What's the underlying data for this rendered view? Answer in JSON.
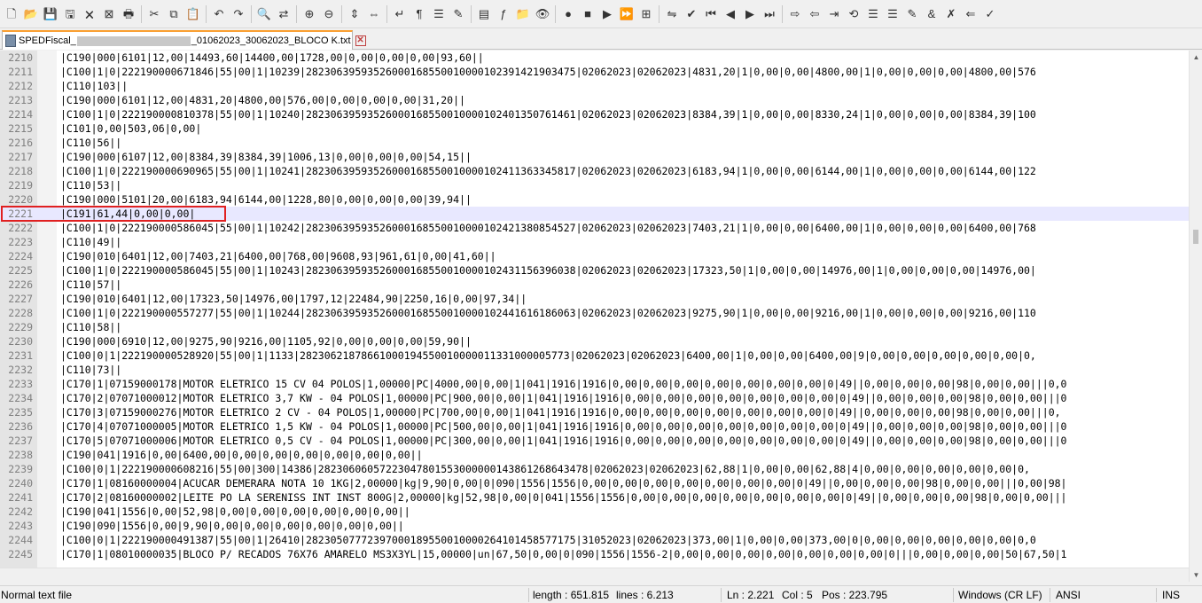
{
  "toolbar": {
    "icons": [
      "new-file-icon",
      "open-file-icon",
      "save-icon",
      "save-all-icon",
      "close-icon",
      "close-all-icon",
      "print-icon",
      "cut-icon",
      "copy-icon",
      "paste-icon",
      "undo-icon",
      "redo-icon",
      "find-icon",
      "replace-icon",
      "zoom-in-icon",
      "zoom-out-icon",
      "sync-vertical-icon",
      "sync-horizontal-icon",
      "word-wrap-icon",
      "show-all-chars-icon",
      "indent-guide-icon",
      "udl-icon",
      "doc-map-icon",
      "function-list-icon",
      "folder-as-workspace-icon",
      "monitoring-icon",
      "record-macro-icon",
      "stop-recording-icon",
      "play-macro-icon",
      "run-macro-multiple-icon",
      "save-macro-icon",
      "compare-icon",
      "compare-check-icon",
      "first-diff-icon",
      "prev-diff-icon",
      "next-diff-icon",
      "last-diff-icon",
      "plugin-a-icon",
      "plugin-b-icon",
      "plugin-c-icon",
      "plugin-d-icon",
      "plugin-e-icon",
      "plugin-f-icon",
      "plugin-g-icon",
      "plugin-h-icon",
      "plugin-i-icon",
      "plugin-j-icon",
      "plugin-k-icon"
    ],
    "glyphs": [
      "🗋",
      "📂",
      "💾",
      "🖫",
      "🗙",
      "⊠",
      "🖶",
      "✂",
      "⧉",
      "📋",
      "↶",
      "↷",
      "🔍",
      "⇄",
      "⊕",
      "⊖",
      "⇕",
      "⇔",
      "↵",
      "¶",
      "☰",
      "✎",
      "▤",
      "ƒ",
      "📁",
      "👁",
      "●",
      "■",
      "▶",
      "⏩",
      "⊞",
      "⇋",
      "✔",
      "⏮",
      "◀",
      "▶",
      "⏭",
      "⇨",
      "⇦",
      "⇥",
      "⟲",
      "☰",
      "☰",
      "✎",
      "&",
      "✗",
      "⇐",
      "✓",
      "🔧"
    ]
  },
  "tab": {
    "prefix": "SPEDFiscal_",
    "suffix": "_01062023_30062023_BLOCO K.txt",
    "close": "✕"
  },
  "editor": {
    "current_line": "2221",
    "lines": [
      {
        "n": "2210",
        "t": "|C190|000|6101|12,00|14493,60|14400,00|1728,00|0,00|0,00|0,00|93,60||"
      },
      {
        "n": "2211",
        "t": "|C100|1|0|222190000671846|55|00|1|10239|28230639593526000168550010000102391421903475|02062023|02062023|4831,20|1|0,00|0,00|4800,00|1|0,00|0,00|0,00|4800,00|576"
      },
      {
        "n": "2212",
        "t": "|C110|103||"
      },
      {
        "n": "2213",
        "t": "|C190|000|6101|12,00|4831,20|4800,00|576,00|0,00|0,00|0,00|31,20||"
      },
      {
        "n": "2214",
        "t": "|C100|1|0|222190000810378|55|00|1|10240|28230639593526000168550010000102401350761461|02062023|02062023|8384,39|1|0,00|0,00|8330,24|1|0,00|0,00|0,00|8384,39|100"
      },
      {
        "n": "2215",
        "t": "|C101|0,00|503,06|0,00|"
      },
      {
        "n": "2216",
        "t": "|C110|56||"
      },
      {
        "n": "2217",
        "t": "|C190|000|6107|12,00|8384,39|8384,39|1006,13|0,00|0,00|0,00|54,15||"
      },
      {
        "n": "2218",
        "t": "|C100|1|0|222190000690965|55|00|1|10241|28230639593526000168550010000102411363345817|02062023|02062023|6183,94|1|0,00|0,00|6144,00|1|0,00|0,00|0,00|6144,00|122"
      },
      {
        "n": "2219",
        "t": "|C110|53||"
      },
      {
        "n": "2220",
        "t": "|C190|000|5101|20,00|6183,94|6144,00|1228,80|0,00|0,00|0,00|39,94||"
      },
      {
        "n": "2221",
        "t": "|C191|61,44|0,00|0,00|"
      },
      {
        "n": "2222",
        "t": "|C100|1|0|222190000586045|55|00|1|10242|28230639593526000168550010000102421380854527|02062023|02062023|7403,21|1|0,00|0,00|6400,00|1|0,00|0,00|0,00|6400,00|768"
      },
      {
        "n": "2223",
        "t": "|C110|49||"
      },
      {
        "n": "2224",
        "t": "|C190|010|6401|12,00|7403,21|6400,00|768,00|9608,93|961,61|0,00|41,60||"
      },
      {
        "n": "2225",
        "t": "|C100|1|0|222190000586045|55|00|1|10243|28230639593526000168550010000102431156396038|02062023|02062023|17323,50|1|0,00|0,00|14976,00|1|0,00|0,00|0,00|14976,00|"
      },
      {
        "n": "2226",
        "t": "|C110|57||"
      },
      {
        "n": "2227",
        "t": "|C190|010|6401|12,00|17323,50|14976,00|1797,12|22484,90|2250,16|0,00|97,34||"
      },
      {
        "n": "2228",
        "t": "|C100|1|0|222190000557277|55|00|1|10244|28230639593526000168550010000102441616186063|02062023|02062023|9275,90|1|0,00|0,00|9216,00|1|0,00|0,00|0,00|9216,00|110"
      },
      {
        "n": "2229",
        "t": "|C110|58||"
      },
      {
        "n": "2230",
        "t": "|C190|000|6910|12,00|9275,90|9216,00|1105,92|0,00|0,00|0,00|59,90||"
      },
      {
        "n": "2231",
        "t": "|C100|0|1|222190000528920|55|00|1|1133|28230621878661000194550010000011331000005773|02062023|02062023|6400,00|1|0,00|0,00|6400,00|9|0,00|0,00|0,00|0,00|0,00|0,"
      },
      {
        "n": "2232",
        "t": "|C110|73||"
      },
      {
        "n": "2233",
        "t": "|C170|1|07159000178|MOTOR ELETRICO 15 CV 04 POLOS|1,00000|PC|4000,00|0,00|1|041|1916|1916|0,00|0,00|0,00|0,00|0,00|0,00|0,00|0|49||0,00|0,00|0,00|98|0,00|0,00|||0,0"
      },
      {
        "n": "2234",
        "t": "|C170|2|07071000012|MOTOR ELETRICO 3,7 KW - 04 POLOS|1,00000|PC|900,00|0,00|1|041|1916|1916|0,00|0,00|0,00|0,00|0,00|0,00|0,00|0|49||0,00|0,00|0,00|98|0,00|0,00|||0"
      },
      {
        "n": "2235",
        "t": "|C170|3|07159000276|MOTOR ELETRICO 2 CV - 04 POLOS|1,00000|PC|700,00|0,00|1|041|1916|1916|0,00|0,00|0,00|0,00|0,00|0,00|0,00|0|49||0,00|0,00|0,00|98|0,00|0,00|||0,"
      },
      {
        "n": "2236",
        "t": "|C170|4|07071000005|MOTOR ELETRICO 1,5 KW - 04 POLOS|1,00000|PC|500,00|0,00|1|041|1916|1916|0,00|0,00|0,00|0,00|0,00|0,00|0,00|0|49||0,00|0,00|0,00|98|0,00|0,00|||0"
      },
      {
        "n": "2237",
        "t": "|C170|5|07071000006|MOTOR ELETRICO 0,5 CV - 04 POLOS|1,00000|PC|300,00|0,00|1|041|1916|1916|0,00|0,00|0,00|0,00|0,00|0,00|0,00|0|49||0,00|0,00|0,00|98|0,00|0,00|||0"
      },
      {
        "n": "2238",
        "t": "|C190|041|1916|0,00|6400,00|0,00|0,00|0,00|0,00|0,00|0,00||"
      },
      {
        "n": "2239",
        "t": "|C100|0|1|222190000608216|55|00|300|14386|28230606057223047801553000000143861268643478|02062023|02062023|62,88|1|0,00|0,00|62,88|4|0,00|0,00|0,00|0,00|0,00|0,"
      },
      {
        "n": "2240",
        "t": "|C170|1|08160000004|ACUCAR DEMERARA NOTA 10 1KG|2,00000|kg|9,90|0,00|0|090|1556|1556|0,00|0,00|0,00|0,00|0,00|0,00|0,00|0|49||0,00|0,00|0,00|98|0,00|0,00|||0,00|98|"
      },
      {
        "n": "2241",
        "t": "|C170|2|08160000002|LEITE PO LA SERENISS INT INST 800G|2,00000|kg|52,98|0,00|0|041|1556|1556|0,00|0,00|0,00|0,00|0,00|0,00|0,00|0|49||0,00|0,00|0,00|98|0,00|0,00|||"
      },
      {
        "n": "2242",
        "t": "|C190|041|1556|0,00|52,98|0,00|0,00|0,00|0,00|0,00|0,00||"
      },
      {
        "n": "2243",
        "t": "|C190|090|1556|0,00|9,90|0,00|0,00|0,00|0,00|0,00|0,00||"
      },
      {
        "n": "2244",
        "t": "|C100|0|1|222190000491387|55|00|1|26410|28230507772397000189550010000264101458577175|31052023|02062023|373,00|1|0,00|0,00|373,00|0|0,00|0,00|0,00|0,00|0,00|0,0"
      },
      {
        "n": "2245",
        "t": "|C170|1|08010000035|BLOCO P/ RECADOS 76X76 AMARELO MS3X3YL|15,00000|un|67,50|0,00|0|090|1556|1556-2|0,00|0,00|0,00|0,00|0,00|0,00|0,00|0|||0,00|0,00|0,00|50|67,50|1"
      }
    ]
  },
  "statusbar": {
    "filetype": "Normal text file",
    "length": "length : 651.815",
    "lines": "lines : 6.213",
    "ln": "Ln : 2.221",
    "col": "Col : 5",
    "pos": "Pos : 223.795",
    "eol": "Windows (CR LF)",
    "encoding": "ANSI",
    "mode": "INS"
  }
}
